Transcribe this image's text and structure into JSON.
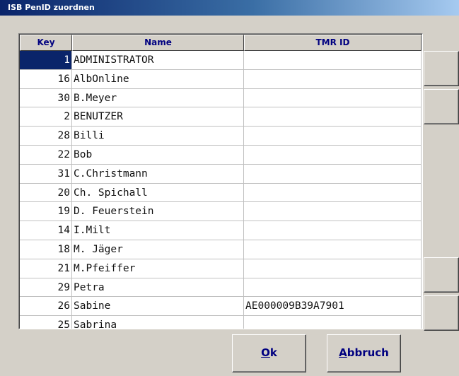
{
  "window": {
    "title": "ISB PenID zuordnen"
  },
  "grid": {
    "columns": {
      "key": "Key",
      "name": "Name",
      "tmr": "TMR ID"
    },
    "rows": [
      {
        "key": "1",
        "name": "ADMINISTRATOR",
        "tmr": ""
      },
      {
        "key": "16",
        "name": "AlbOnline",
        "tmr": ""
      },
      {
        "key": "30",
        "name": "B.Meyer",
        "tmr": ""
      },
      {
        "key": "2",
        "name": "BENUTZER",
        "tmr": ""
      },
      {
        "key": "28",
        "name": "Billi",
        "tmr": ""
      },
      {
        "key": "22",
        "name": "Bob",
        "tmr": ""
      },
      {
        "key": "31",
        "name": "C.Christmann",
        "tmr": ""
      },
      {
        "key": "20",
        "name": "Ch. Spichall",
        "tmr": ""
      },
      {
        "key": "19",
        "name": "D. Feuerstein",
        "tmr": ""
      },
      {
        "key": "14",
        "name": "I.Milt",
        "tmr": ""
      },
      {
        "key": "18",
        "name": "M. Jäger",
        "tmr": ""
      },
      {
        "key": "21",
        "name": "M.Pfeiffer",
        "tmr": ""
      },
      {
        "key": "29",
        "name": "Petra",
        "tmr": ""
      },
      {
        "key": "26",
        "name": "Sabine",
        "tmr": "AE000009B39A7901"
      },
      {
        "key": "25",
        "name": "Sabrina",
        "tmr": ""
      }
    ]
  },
  "buttons": {
    "ok": {
      "accel": "O",
      "rest": "k"
    },
    "cancel": {
      "accel": "A",
      "rest": "bbruch"
    }
  },
  "colors": {
    "title_bar": "#0a246a",
    "selection": "#0a246a",
    "header_text": "#000080",
    "face": "#d4d0c8"
  }
}
